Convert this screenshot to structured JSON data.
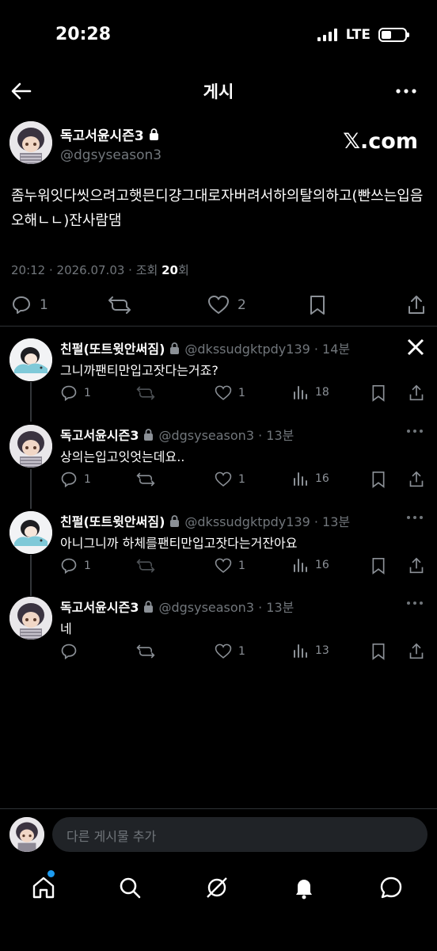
{
  "status_bar": {
    "time": "20:28",
    "network": "LTE"
  },
  "header": {
    "title": "게시"
  },
  "post": {
    "author_name": "독고서윤시즌3",
    "author_handle": "@dgsyseason3",
    "brand": "𝕏.com",
    "text": "좀누워잇다씻으려고햇믄디걍그대로자버려서하의탈의하고(빤쓰는입음오해ㄴㄴ)잔사람댐",
    "meta_prefix": "20:12 · 2026.07.03 · 조회 ",
    "views": "20",
    "meta_suffix": "회",
    "replies": "1",
    "likes": "2"
  },
  "replies": [
    {
      "name": "친펄(또트윗안써짐)",
      "handle": "@dkssudgktpdy139 · 14분",
      "text": "그니까팬티만입고잣다는거죠?",
      "replies": "1",
      "likes": "1",
      "views": "18",
      "avatar": "green"
    },
    {
      "name": "독고서윤시즌3",
      "handle": "@dgsyseason3 · 13분",
      "text": "상의는입고잇엇는데요..",
      "replies": "1",
      "likes": "1",
      "views": "16",
      "avatar": "purple"
    },
    {
      "name": "친펄(또트윗안써짐)",
      "handle": "@dkssudgktpdy139 · 13분",
      "text": "아니그니까 하체를팬티만입고잣다는거잔아요",
      "replies": "1",
      "likes": "1",
      "views": "16",
      "avatar": "green"
    },
    {
      "name": "독고서윤시즌3",
      "handle": "@dgsyseason3 · 13분",
      "text": "네",
      "replies": "",
      "likes": "1",
      "views": "13",
      "avatar": "purple"
    }
  ],
  "compose": {
    "placeholder": "다른 게시물 추가"
  },
  "tabs": [
    "home-icon",
    "search-icon",
    "grok-icon",
    "notifications-icon",
    "messages-icon"
  ],
  "colors": {
    "background": "#000000",
    "accent": "#1d9bf0",
    "muted": "#71767b"
  }
}
